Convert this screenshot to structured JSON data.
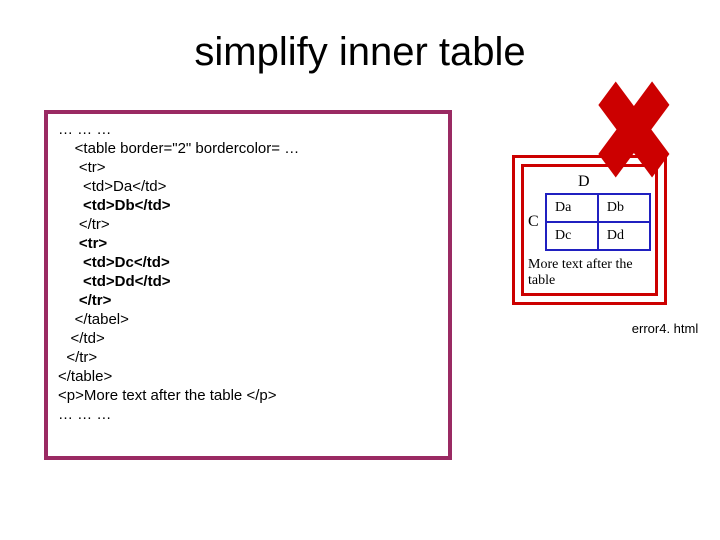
{
  "title": "simplify inner table",
  "code": {
    "l1": "… … …",
    "l2": "    <table border=\"2\" bordercolor= …",
    "l3": "     <tr>",
    "l4": "      <td>Da</td>",
    "l5": "      <td>Db</td>",
    "l6": "     </tr>",
    "l7": "     <tr>",
    "l8": "      <td>Dc</td>",
    "l9": "      <td>Dd</td>",
    "l10": "     </tr>",
    "l11": "    </tabel>",
    "l12": "   </td>",
    "l13": "  </tr>",
    "l14": "</table>",
    "l15": "<p>More text after the table </p>",
    "l16": "… … …"
  },
  "preview": {
    "dLabel": "D",
    "cLabel": "C",
    "cells": {
      "da": "Da",
      "db": "Db",
      "dc": "Dc",
      "dd": "Dd"
    },
    "caption": "More text after the table"
  },
  "xmark": "✖",
  "filename": "error4. html"
}
